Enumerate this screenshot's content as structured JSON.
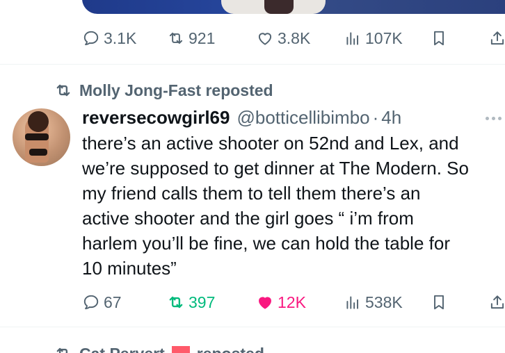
{
  "prev_tweet": {
    "actions": {
      "replies": "3.1K",
      "reposts": "921",
      "likes": "3.8K",
      "views": "107K"
    }
  },
  "repost_banner": {
    "text": "Molly Jong-Fast reposted"
  },
  "tweet": {
    "display_name": "reversecowgirl69",
    "handle": "@botticellibimbo",
    "separator": "·",
    "time": "4h",
    "text_lines": [
      "there’s an active shooter on 52nd and Lex, and",
      "we’re supposed to get dinner at The Modern. So",
      "my friend calls them to tell them there’s an",
      "active shooter and the girl goes “ i’m from",
      "harlem you’ll be fine, we can hold the table for",
      "10 minutes”"
    ],
    "actions": {
      "replies": "67",
      "reposts": "397",
      "likes": "12K",
      "views": "538K"
    },
    "liked": true,
    "reposted": true
  },
  "next_repost_banner": {
    "name": "Cat Pervert",
    "suffix": "reposted"
  },
  "colors": {
    "muted": "#536471",
    "repost_active": "#00ba7c",
    "like_active": "#f91880",
    "divider": "#eff3f4"
  },
  "icons": {
    "reply": "speech-bubble-icon",
    "repost": "repost-arrows-icon",
    "like": "heart-icon",
    "views": "bar-chart-icon",
    "bookmark": "bookmark-icon",
    "share": "share-icon",
    "more": "more-dots-icon"
  }
}
